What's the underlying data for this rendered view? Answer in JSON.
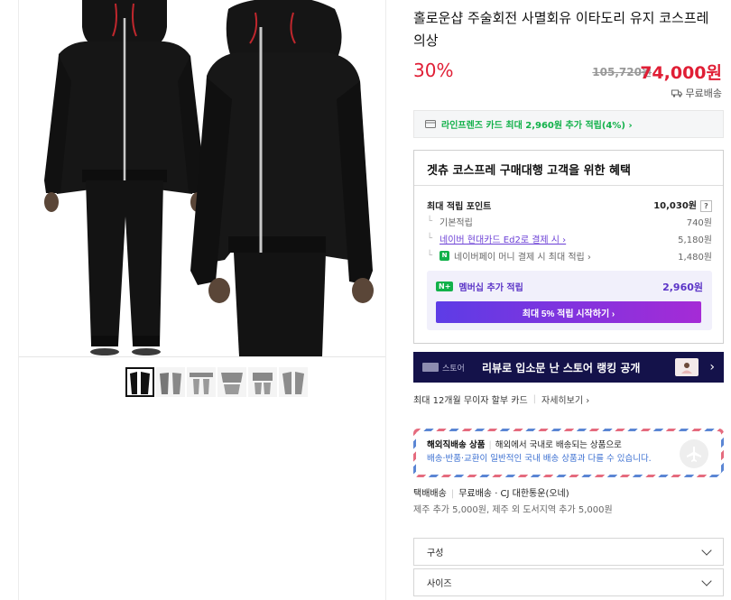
{
  "product": {
    "title": "홀로운샵 주술회전 사멸회유 이타도리 유지 코스프레 의상",
    "discount": "30%",
    "original_price": "105,720원",
    "sale_price": "74,000원",
    "shipping": "무료배송"
  },
  "card_offer": {
    "text": "라인프렌즈 카드 최대 2,960원 추가 적립(4%) ›"
  },
  "benefit": {
    "title": "겟츄 코스프레 구매대행 고객을 위한 혜택",
    "max_point_label": "최대 적립 포인트",
    "max_point_value": "10,030원",
    "help": "?",
    "rows": [
      {
        "label": "기본적립",
        "value": "740원"
      },
      {
        "label": "네이버 현대카드 Ed2로 결제 시 ›",
        "value": "5,180원"
      },
      {
        "label": "네이버페이 머니 결제 시 최대 적립 ›",
        "value": "1,480원"
      }
    ],
    "npay_icon": "N",
    "membership": {
      "badge": "N+",
      "label": "멤버십 추가 적립",
      "value": "2,960원",
      "button": "최대 5% 적립 시작하기 ›"
    }
  },
  "store_banner": {
    "tag": "스토어",
    "text": "리뷰로 입소문 난 스토어 랭킹 공개",
    "arrow": "›"
  },
  "installment": {
    "text": "최대 12개월 무이자 할부 카드",
    "more": "자세히보기 ›"
  },
  "overseas": {
    "strong": "해외직배송 상품",
    "line1": "해외에서 국내로 배송되는 상품으로",
    "line2": "배송·반품·교환이 일반적인 국내 배송 상품과 다를 수 있습니다."
  },
  "delivery": {
    "type": "택배배송",
    "fee": "무료배송",
    "courier": "· CJ 대한통운(오네)",
    "extra": "제주 추가 5,000원, 제주 외 도서지역 추가 5,000원"
  },
  "options": [
    {
      "label": "구성"
    },
    {
      "label": "사이즈"
    }
  ],
  "colors": {
    "sale": "#e01e35",
    "naver_green": "#12b14a",
    "purple": "#5b34c7",
    "banner_navy": "#14124a"
  }
}
